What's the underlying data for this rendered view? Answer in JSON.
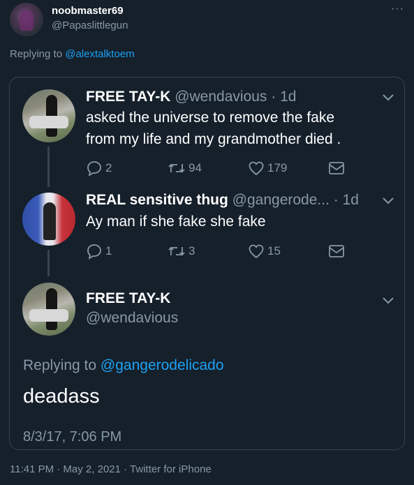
{
  "header": {
    "display_name": "noobmaster69",
    "handle": "@Papaslittlegun",
    "more": "···",
    "replying_prefix": "Replying to ",
    "replying_to": "@alextalktoem"
  },
  "quoted_thread": {
    "tweet1": {
      "name": "FREE TAY-K",
      "meta": "@wendavious · 1d",
      "text_line1": "asked the universe to remove the fake",
      "text_line2": "from my life and my grandmother died .",
      "replies": "2",
      "retweets": "94",
      "likes": "179"
    },
    "tweet2": {
      "name": "REAL sensitive thug",
      "meta": "@gangerode... · 1d",
      "text": "Ay man if she fake she fake",
      "replies": "1",
      "retweets": "3",
      "likes": "15"
    },
    "tweet3": {
      "name": "FREE TAY-K",
      "handle": "@wendavious",
      "replying_prefix": "Replying to ",
      "replying_to": "@gangerodelicado",
      "text": "deadass",
      "timestamp": "8/3/17, 7:06 PM"
    }
  },
  "footer": {
    "text": "11:41 PM · May 2, 2021 · Twitter for iPhone"
  },
  "colors": {
    "background": "#15202b",
    "border": "#38444d",
    "secondary_text": "#8899a6",
    "link": "#1da1f2"
  }
}
